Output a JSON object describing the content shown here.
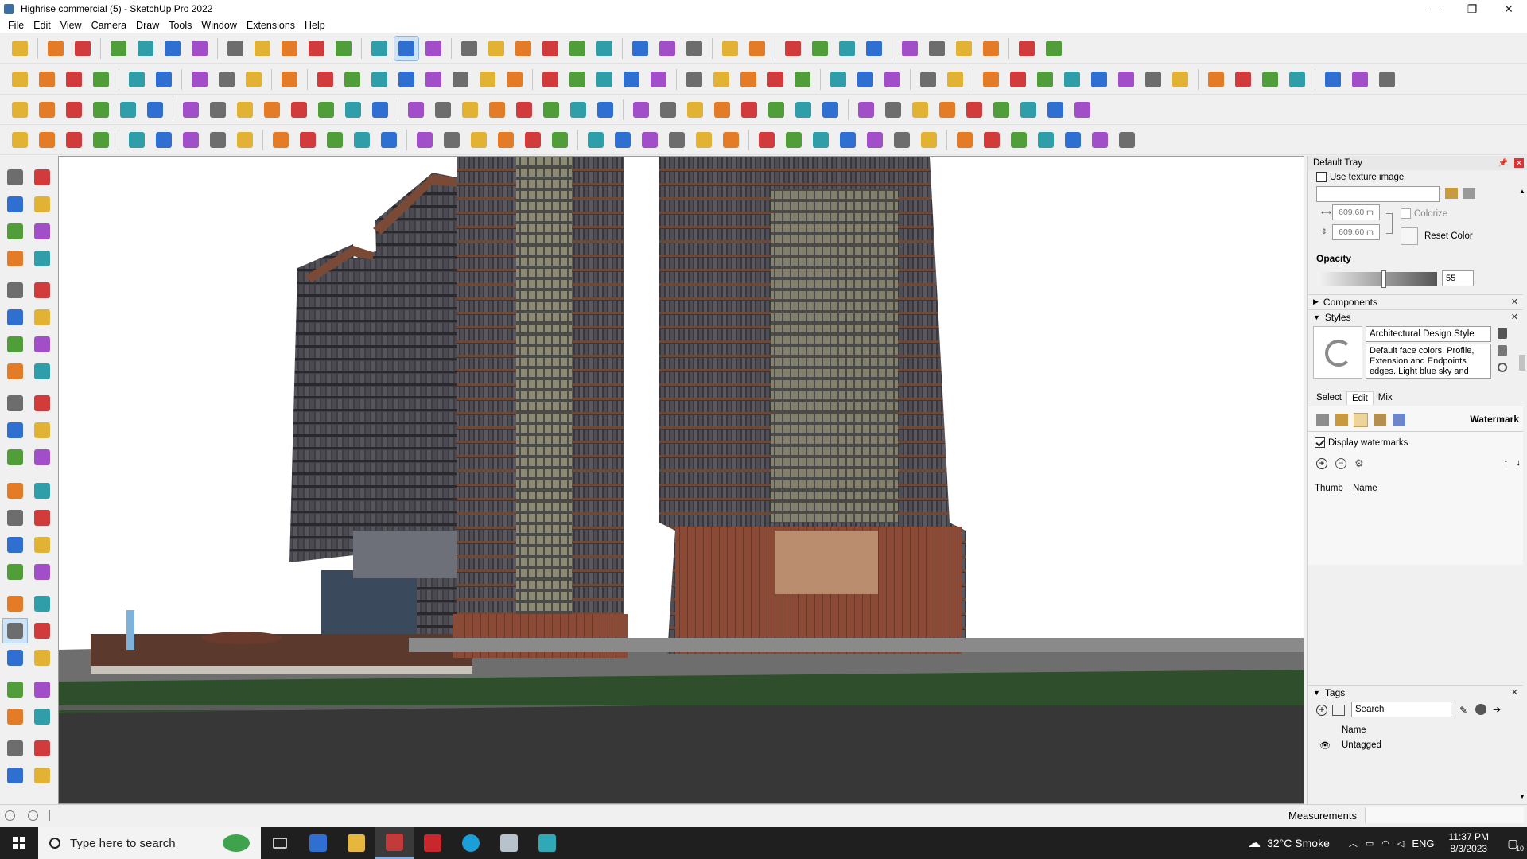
{
  "window": {
    "title": "Highrise commercial (5) - SketchUp Pro 2022",
    "controls": [
      "—",
      "❐",
      "✕"
    ]
  },
  "menu": [
    "File",
    "Edit",
    "View",
    "Camera",
    "Draw",
    "Tools",
    "Window",
    "Extensions",
    "Help"
  ],
  "toolbar_colors": {
    "red": "#d23b3b",
    "blue": "#2f6fd1",
    "yellow": "#e2b235",
    "green": "#4f9e3a",
    "purple": "#a34ec9",
    "gray": "#6d6d6d",
    "orange": "#e47b26",
    "teal": "#2f9ea8"
  },
  "default_tray": {
    "title": "Default Tray",
    "use_texture_label": "Use texture image",
    "width_value": "609.60 m",
    "height_value": "609.60 m",
    "colorize_label": "Colorize",
    "reset_color_label": "Reset Color",
    "opacity_label": "Opacity",
    "opacity_value": "55",
    "components_label": "Components",
    "styles_label": "Styles",
    "style_name": "Architectural Design Style",
    "style_description": "Default face colors. Profile, Extension and Endpoints edges. Light blue sky and gray",
    "tabs": [
      "Select",
      "Edit",
      "Mix"
    ],
    "watermark_label": "Watermark",
    "display_watermarks_label": "Display watermarks",
    "thumb_header": "Thumb",
    "name_header": "Name",
    "tags_label": "Tags",
    "tags_search_placeholder": "Search",
    "tags_name_header": "Name",
    "tags_items": [
      "Untagged"
    ]
  },
  "status": {
    "measurements_label": "Measurements"
  },
  "taskbar": {
    "search_placeholder": "Type here to search",
    "weather": "32°C  Smoke",
    "language": "ENG",
    "time": "11:37 PM",
    "date": "8/3/2023",
    "notifications": "10"
  }
}
